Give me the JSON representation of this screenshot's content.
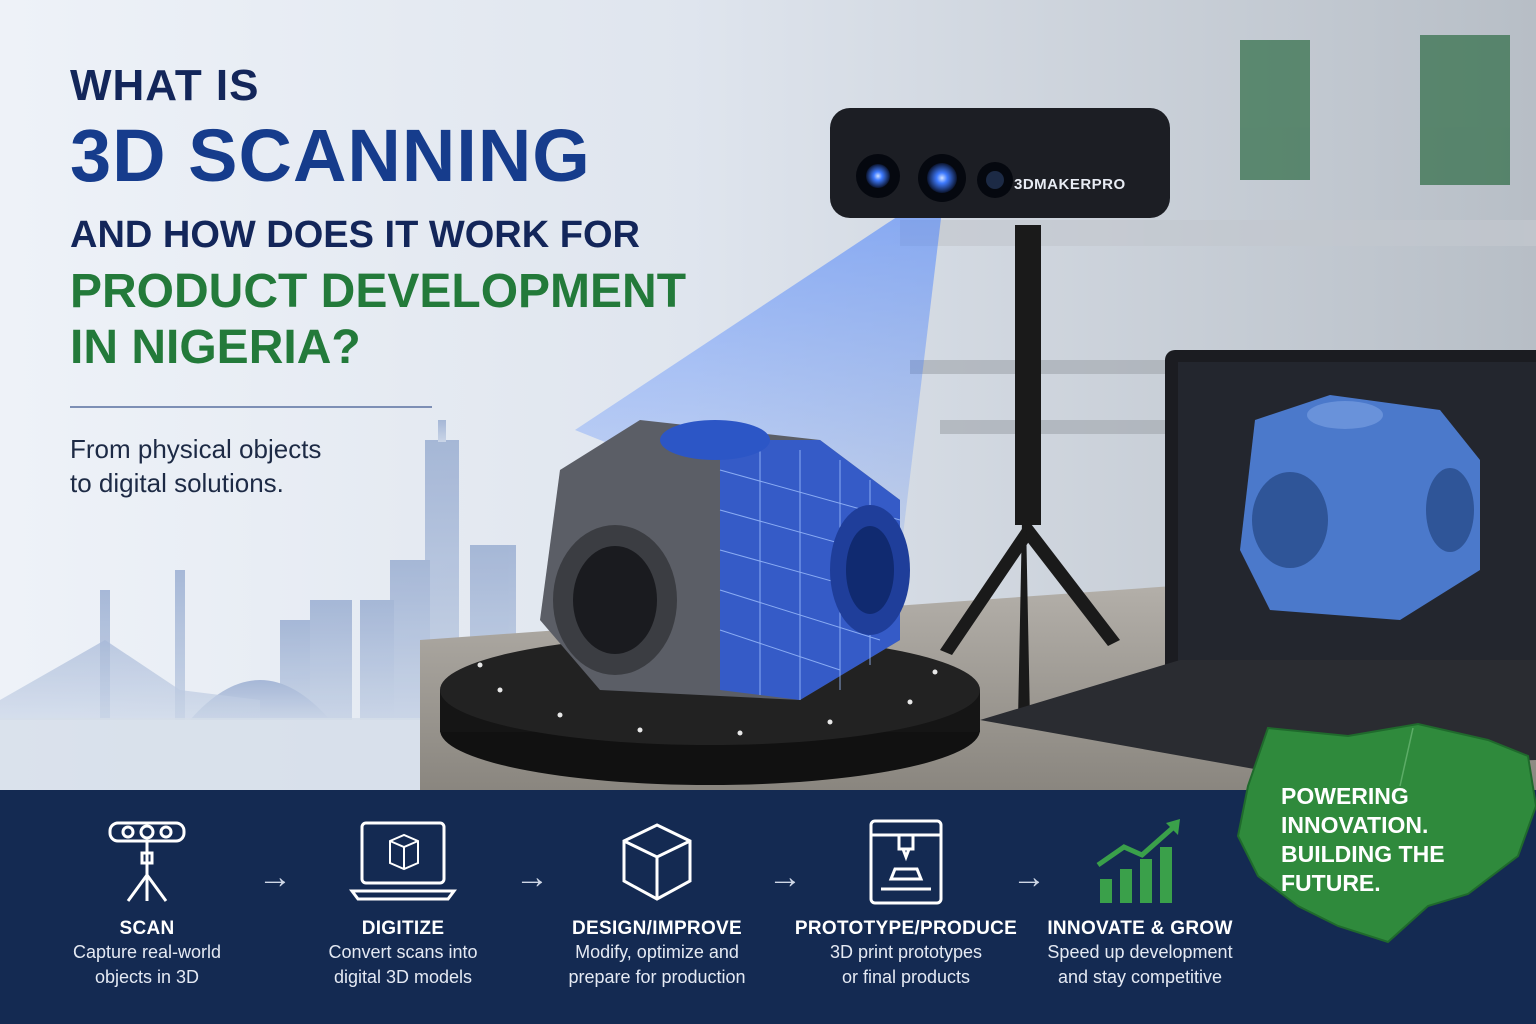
{
  "headline": {
    "line1": "WHAT IS",
    "line2": "3D SCANNING",
    "line3": "AND HOW DOES IT WORK FOR",
    "line4": "PRODUCT DEVELOPMENT",
    "line5": "IN NIGERIA?"
  },
  "subtitle": [
    "From physical objects",
    "to digital solutions."
  ],
  "scanner_brand": "3DMAKERPRO",
  "steps": [
    {
      "title": "SCAN",
      "desc": [
        "Capture real-world",
        "objects in 3D"
      ],
      "icon": "scanner-tripod-icon"
    },
    {
      "title": "DIGITIZE",
      "desc": [
        "Convert scans into",
        "digital 3D models"
      ],
      "icon": "laptop-model-icon"
    },
    {
      "title": "DESIGN/IMPROVE",
      "desc": [
        "Modify, optimize and",
        "prepare for production"
      ],
      "icon": "cube-icon"
    },
    {
      "title": "PROTOTYPE/PRODUCE",
      "desc": [
        "3D print prototypes",
        "or final products"
      ],
      "icon": "3d-printer-icon"
    },
    {
      "title": "INNOVATE & GROW",
      "desc": [
        "Speed up development",
        "and stay competitive"
      ],
      "icon": "growth-chart-icon"
    }
  ],
  "arrow_glyph": "→",
  "tagline": [
    "POWERING",
    "INNOVATION.",
    "BUILDING THE",
    "FUTURE."
  ],
  "colors": {
    "navy": "#142a52",
    "title_blue": "#163c8c",
    "green": "#237a3a",
    "scan_blue": "#2f6ff0"
  }
}
